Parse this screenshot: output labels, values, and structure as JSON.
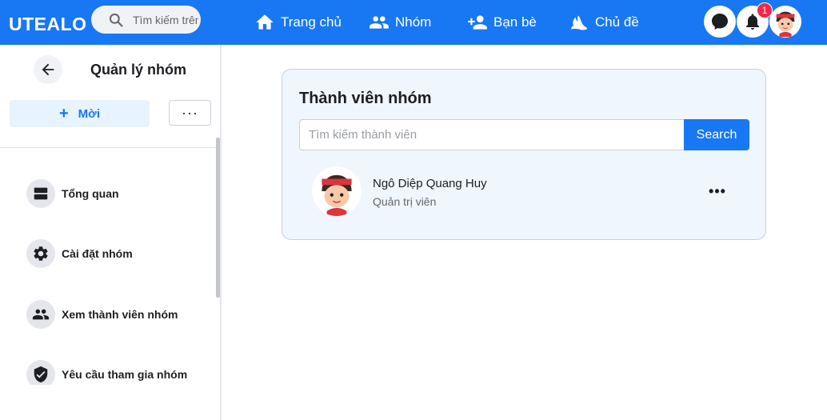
{
  "app": {
    "brand": "UTEALO"
  },
  "search": {
    "placeholder": "Tìm kiếm trên UTEALO"
  },
  "nav": {
    "home": "Trang chủ",
    "groups": "Nhóm",
    "friends": "Bạn bè",
    "topics": "Chủ đề"
  },
  "notifications": {
    "count": "1"
  },
  "sidebar": {
    "title": "Quản lý nhóm",
    "invite_label": "Mời",
    "more_label": "···",
    "items": [
      {
        "label": "Tổng quan",
        "icon": "overview-icon"
      },
      {
        "label": "Cài đặt nhóm",
        "icon": "gear-icon"
      },
      {
        "label": "Xem thành viên nhóm",
        "icon": "people-icon"
      },
      {
        "label": "Yêu cầu tham gia nhóm",
        "icon": "shield-check-icon"
      }
    ]
  },
  "members": {
    "title": "Thành viên nhóm",
    "search_placeholder": "Tìm kiếm thành viên",
    "search_button": "Search",
    "list": [
      {
        "name": "Ngô Diệp Quang Huy",
        "role": "Quản trị viên",
        "more": "•••"
      }
    ]
  },
  "colors": {
    "primary": "#1877f2",
    "badge": "#f02849",
    "card_bg": "#f0f6fd"
  }
}
